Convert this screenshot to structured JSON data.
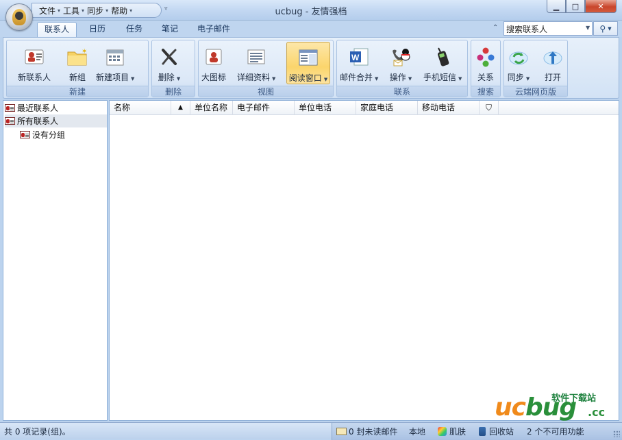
{
  "window": {
    "title": "ucbug - 友情强档"
  },
  "menu": [
    "文件",
    "工具",
    "同步",
    "帮助"
  ],
  "tabs": [
    "联系人",
    "日历",
    "任务",
    "笔记",
    "电子邮件"
  ],
  "search": {
    "value": "搜索联系人"
  },
  "ribbon": {
    "groups": [
      {
        "label": "新建",
        "buttons": [
          "新联系人",
          "新组",
          "新建项目"
        ]
      },
      {
        "label": "删除",
        "buttons": [
          "删除"
        ]
      },
      {
        "label": "视图",
        "buttons": [
          "大图标",
          "详细资料",
          "阅读窗口"
        ]
      },
      {
        "label": "联系",
        "buttons": [
          "邮件合并",
          "操作",
          "手机短信"
        ]
      },
      {
        "label": "搜索",
        "buttons": [
          "关系"
        ]
      },
      {
        "label": "云端网页版",
        "buttons": [
          "同步",
          "打开"
        ]
      }
    ]
  },
  "tree": [
    "最近联系人",
    "所有联系人",
    "没有分组"
  ],
  "columns": [
    "名称",
    "单位名称",
    "电子邮件",
    "单位电话",
    "家庭电话",
    "移动电话"
  ],
  "status": {
    "records": "共 0 项记录(组)。",
    "unread": "0 封未读邮件",
    "local": "本地",
    "skin": "肌肤",
    "recycle": "回收站",
    "unavailable": "2 个不可用功能"
  },
  "watermark": {
    "small": "软件下载站",
    "big_u": "uc",
    "big_rest": "bug",
    "cc": ".cc"
  }
}
